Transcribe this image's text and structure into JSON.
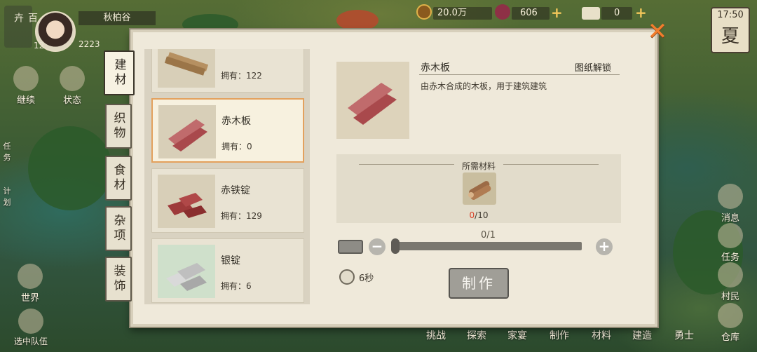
{
  "hud": {
    "badge": "百卉",
    "level": "12",
    "player_name": "秋柏谷",
    "stat": "2223",
    "coins": "20.0万",
    "gems": "606",
    "tickets": "0",
    "time": "17:50",
    "season": "夏"
  },
  "left_menu": [
    "继续",
    "状态",
    "任务",
    "计划",
    "世界",
    "选中队伍"
  ],
  "right_menu": [
    "消息",
    "任务",
    "村民",
    "仓库"
  ],
  "bottom_menu": [
    "挑战",
    "探索",
    "家宴",
    "制作",
    "材料",
    "建造",
    "勇士"
  ],
  "tabs": [
    "建材",
    "织物",
    "食材",
    "杂项",
    "装饰"
  ],
  "active_tab": 0,
  "items": [
    {
      "name": "",
      "owned": "拥有：122",
      "icon": "wood-plank-icon"
    },
    {
      "name": "赤木板",
      "owned": "拥有：0",
      "icon": "red-wood-plank-icon",
      "selected": true
    },
    {
      "name": "赤铁锭",
      "owned": "拥有：129",
      "icon": "red-iron-ingot-icon"
    },
    {
      "name": "银锭",
      "owned": "拥有：6",
      "icon": "silver-ingot-icon"
    }
  ],
  "detail": {
    "title": "赤木板",
    "tag": "图纸解锁",
    "description": "由赤木合成的木板，用于建筑建筑",
    "materials_title": "所需材料",
    "material_have": "0",
    "material_need": "/10",
    "quantity": "0/1",
    "time": "6秒",
    "craft_label": "制作"
  },
  "colors": {
    "accent_orange": "#f27d2d",
    "selected_border": "#e3a15d",
    "insufficient": "#d9442b"
  }
}
